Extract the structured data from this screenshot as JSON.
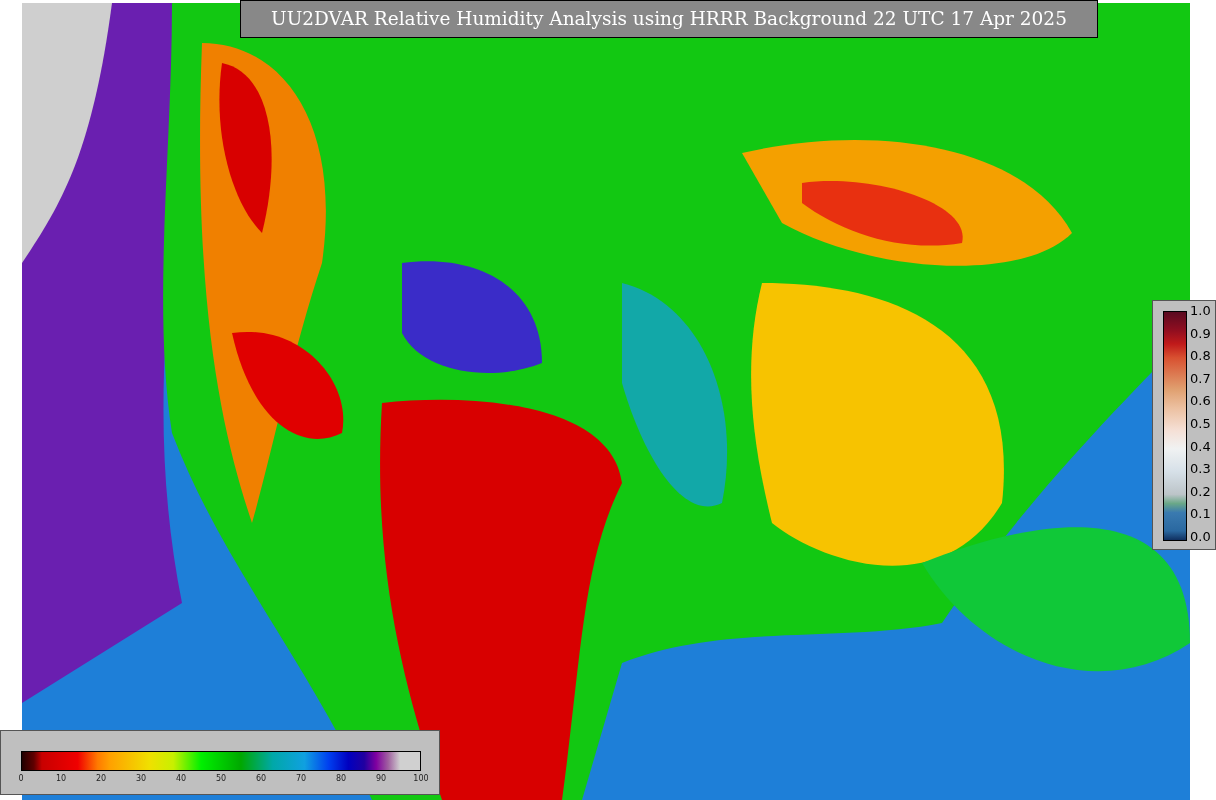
{
  "title": "UU2DVAR Relative Humidity Analysis using HRRR Background 22 UTC 17 Apr 2025",
  "humidity_scale": {
    "ticks": [
      "0",
      "10",
      "20",
      "30",
      "40",
      "50",
      "60",
      "70",
      "80",
      "90",
      "100"
    ]
  },
  "ratio_scale": {
    "ticks": [
      "1.0",
      "0.9",
      "0.8",
      "0.7",
      "0.6",
      "0.5",
      "0.4",
      "0.3",
      "0.2",
      "0.1",
      "0.0"
    ]
  }
}
